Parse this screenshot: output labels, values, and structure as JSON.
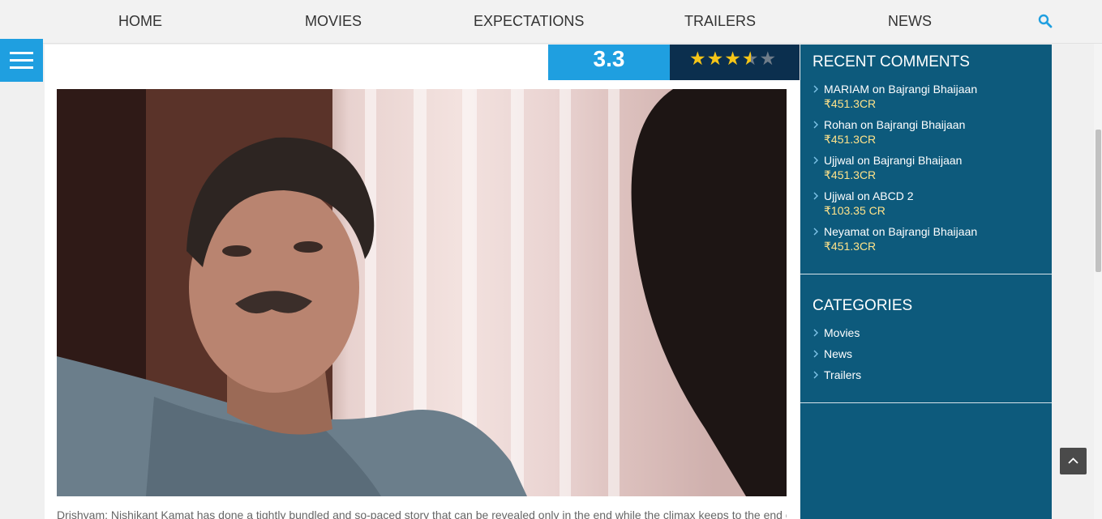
{
  "nav": {
    "items": [
      {
        "label": "HOME"
      },
      {
        "label": "MOVIES"
      },
      {
        "label": "EXPECTATIONS"
      },
      {
        "label": "TRAILERS"
      },
      {
        "label": "NEWS"
      }
    ],
    "search_icon": "search-icon"
  },
  "menu_icon": "hamburger-menu-icon",
  "rating": {
    "score": "3.3",
    "stars_value": 3.3,
    "stars_max": 5
  },
  "article": {
    "excerpt": "Drishyam: Nishikant Kamat has done a tightly bundled and so-paced story that can be revealed only in the end while the climax keeps to the end of the film. It. The climax. If"
  },
  "sidebar": {
    "recent_comments": {
      "title": "RECENT COMMENTS",
      "items": [
        {
          "author": "MARIAM",
          "on": "on",
          "post": "Bajrangi Bhaijaan",
          "value": "₹451.3CR"
        },
        {
          "author": "Rohan",
          "on": "on",
          "post": "Bajrangi Bhaijaan",
          "value": "₹451.3CR"
        },
        {
          "author": "Ujjwal",
          "on": "on",
          "post": "Bajrangi Bhaijaan",
          "value": "₹451.3CR"
        },
        {
          "author": "Ujjwal",
          "on": "on",
          "post": "ABCD 2",
          "value": "₹103.35 CR"
        },
        {
          "author": "Neyamat",
          "on": "on",
          "post": "Bajrangi Bhaijaan",
          "value": "₹451.3CR"
        }
      ]
    },
    "categories": {
      "title": "CATEGORIES",
      "items": [
        {
          "label": "Movies"
        },
        {
          "label": "News"
        },
        {
          "label": "Trailers"
        }
      ]
    }
  },
  "scroll_top_icon": "chevron-up-icon",
  "colors": {
    "accent": "#1f9fe0",
    "sidebar": "#0d5a7c",
    "stars_bg": "#0b2f4e",
    "star": "#f5c518",
    "comment_value": "#ffe38a"
  }
}
